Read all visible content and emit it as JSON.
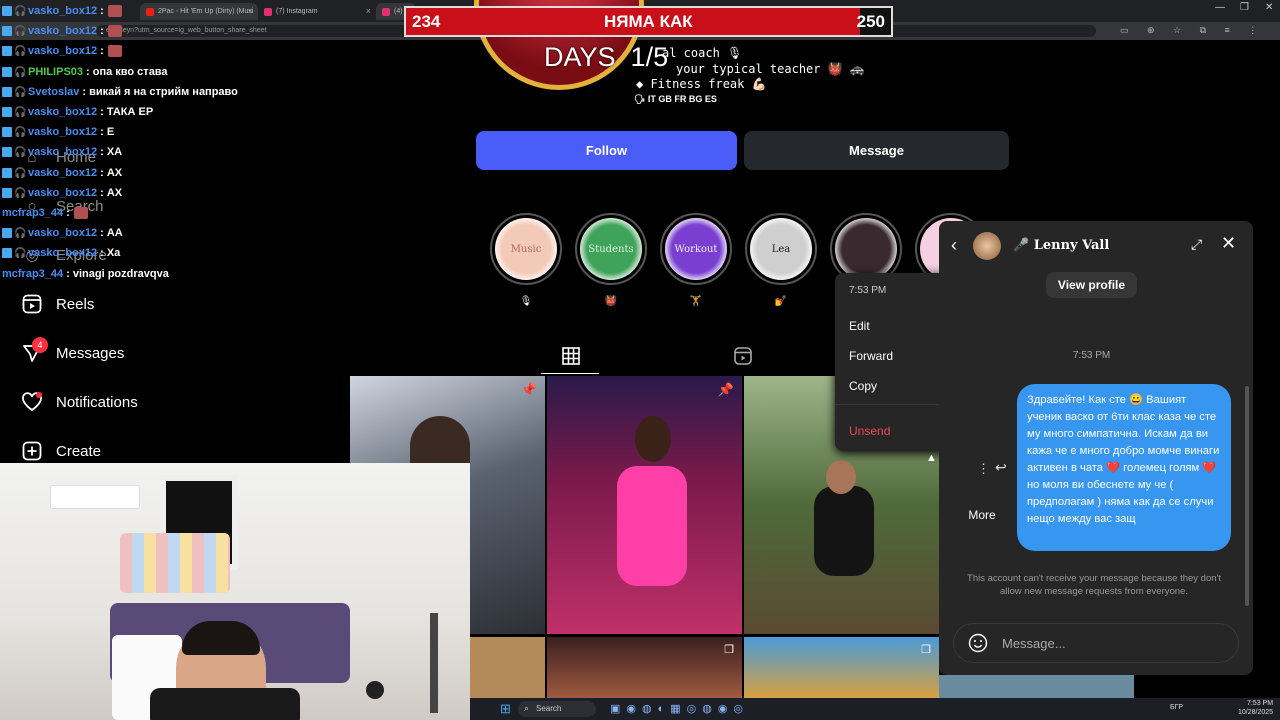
{
  "browser": {
    "tabs": [
      {
        "title": "2Pac - Hit 'Em Up (Dirty) (Musi",
        "color": "#e62117"
      },
      {
        "title": "(7) Instagram",
        "color": "#e1306c"
      },
      {
        "title": "(4) I",
        "color": "#e1306c"
      }
    ],
    "url": "enteileyn?utm_source=ig_web_button_share_sheet",
    "clock_time": "7:53 PM",
    "clock_date": "10/28/2025"
  },
  "stream": {
    "left_value": "234",
    "title": "НЯМА КАК",
    "right_value": "250",
    "progress_fraction": 0.936,
    "days_label": "DAYS",
    "days_value": "1/5"
  },
  "chat": [
    {
      "user": "vasko_box12",
      "msg": ":",
      "emote": true
    },
    {
      "user": "vasko_box12",
      "msg": ":",
      "emote": true
    },
    {
      "user": "vasko_box12",
      "msg": ":",
      "emote": true
    },
    {
      "user": "PHILIPS03",
      "msg": ": опа кво става",
      "green": true
    },
    {
      "user": "Svetoslav",
      "msg": ": викай я на стрийм направо"
    },
    {
      "user": "vasko_box12",
      "msg": ": ТАКА ЕР"
    },
    {
      "user": "vasko_box12",
      "msg": ": Е"
    },
    {
      "user": "vasko_box12",
      "msg": ": ХА"
    },
    {
      "user": "vasko_box12",
      "msg": ": АХ"
    },
    {
      "user": "vasko_box12",
      "msg": ": АХ"
    },
    {
      "user": "mcfrap3_44",
      "msg": ":",
      "emote": true,
      "noicons": true
    },
    {
      "user": "vasko_box12",
      "msg": ": АА"
    },
    {
      "user": "vasko_box12",
      "msg": ": Ха"
    },
    {
      "user": "mcfrap3_44",
      "msg": ": vinagi pozdravqva",
      "noicons": true
    }
  ],
  "sidebar": {
    "home": "Home",
    "search": "Search",
    "explore": "Explore",
    "reels": "Reels",
    "messages": "Messages",
    "messages_badge": "4",
    "notifications": "Notifications",
    "create": "Create"
  },
  "profile": {
    "bio": [
      "al coach 🎙",
      "your typical teacher 👹 🚓",
      "◆ Fitness freak 💪🏻",
      "🗣 IT GB FR BG ES"
    ],
    "follow_label": "Follow",
    "message_label": "Message",
    "highlights": [
      {
        "label": "Music",
        "caption": "🎙",
        "bg": "#f3c9b8",
        "fg": "#b06a5c"
      },
      {
        "label": "Students",
        "caption": "👹",
        "bg": "#3fa35a",
        "fg": "#dff5e3"
      },
      {
        "label": "Workout",
        "caption": "🏋",
        "bg": "#7a3fd1",
        "fg": "#eee"
      },
      {
        "label": "Lea",
        "caption": "💅",
        "bg": "#cfcfcf",
        "fg": "#222"
      },
      {
        "label": "",
        "caption": "",
        "bg": "#3a2a30",
        "fg": "#fff"
      }
    ]
  },
  "context_menu": {
    "time": "7:53 PM",
    "edit": "Edit",
    "forward": "Forward",
    "copy": "Copy",
    "unsend": "Unsend"
  },
  "dm": {
    "name": "Lenny Vall",
    "name_prefix": "🎤",
    "view_profile": "View profile",
    "time": "7:53 PM",
    "message": "Здравейте! Как сте 😀 Вашият ученик васко от 6ти клас каза че сте му много симпатична. Искам да ви кажа че е много добро момче винаги активен в чата ❤️ големец голям ❤️ но моля ви обеснете му че ( предполагам ) няма как да се случи нещо между вас защ",
    "more_label": "More",
    "notice": "This account can't receive your message because they don't allow new message requests from everyone.",
    "input_placeholder": "Message..."
  },
  "taskbar": {
    "search_label": "Search",
    "lang": "БГР"
  }
}
